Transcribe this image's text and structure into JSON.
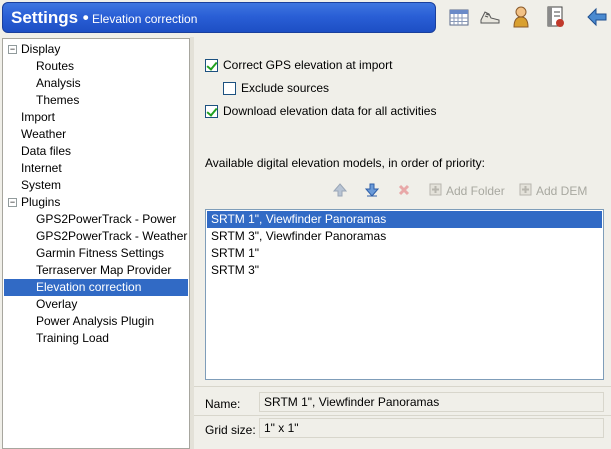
{
  "header": {
    "title": "Settings •",
    "subtitle": "Elevation correction",
    "toolbar_icons": [
      "calendar-icon",
      "shoe-icon",
      "athlete-icon",
      "notebook-icon",
      "back-arrow-icon"
    ],
    "accent_color": "#2a5fd6"
  },
  "tree": {
    "items": [
      {
        "label": "Display",
        "level": 0,
        "expander": "−",
        "selected": false
      },
      {
        "label": "Routes",
        "level": 1,
        "selected": false
      },
      {
        "label": "Analysis",
        "level": 1,
        "selected": false
      },
      {
        "label": "Themes",
        "level": 1,
        "selected": false
      },
      {
        "label": "Import",
        "level": 0,
        "selected": false
      },
      {
        "label": "Weather",
        "level": 0,
        "selected": false
      },
      {
        "label": "Data files",
        "level": 0,
        "selected": false
      },
      {
        "label": "Internet",
        "level": 0,
        "selected": false
      },
      {
        "label": "System",
        "level": 0,
        "selected": false
      },
      {
        "label": "Plugins",
        "level": 0,
        "expander": "−",
        "selected": false
      },
      {
        "label": "GPS2PowerTrack - Power",
        "level": 1,
        "selected": false
      },
      {
        "label": "GPS2PowerTrack - Weather",
        "level": 1,
        "selected": false
      },
      {
        "label": "Garmin Fitness Settings",
        "level": 1,
        "selected": false
      },
      {
        "label": "Terraserver Map Provider",
        "level": 1,
        "selected": false
      },
      {
        "label": "Elevation correction",
        "level": 1,
        "selected": true
      },
      {
        "label": "Overlay",
        "level": 1,
        "selected": false
      },
      {
        "label": "Power Analysis Plugin",
        "level": 1,
        "selected": false
      },
      {
        "label": "Training Load",
        "level": 1,
        "selected": false
      }
    ]
  },
  "options": {
    "correct_gps": {
      "label": "Correct GPS elevation at import",
      "checked": true
    },
    "exclude_sources": {
      "label": "Exclude sources",
      "checked": false
    },
    "download_elevation": {
      "label": "Download elevation data for all activities",
      "checked": true
    }
  },
  "dem": {
    "heading": "Available digital elevation models, in order of priority:",
    "toolbar": {
      "move_up": "arrow-up-icon",
      "move_down": "arrow-down-icon",
      "remove": "delete-x-icon",
      "add_folder": "Add Folder",
      "add_dem": "Add DEM"
    },
    "models": [
      {
        "label": "SRTM 1\", Viewfinder Panoramas",
        "selected": true
      },
      {
        "label": "SRTM 3\", Viewfinder Panoramas",
        "selected": false
      },
      {
        "label": "SRTM 1\"",
        "selected": false
      },
      {
        "label": "SRTM 3\"",
        "selected": false
      }
    ]
  },
  "details": {
    "name_label": "Name:",
    "name_value": "SRTM 1\", Viewfinder Panoramas",
    "grid_label": "Grid size:",
    "grid_value": "1\" x 1\""
  }
}
